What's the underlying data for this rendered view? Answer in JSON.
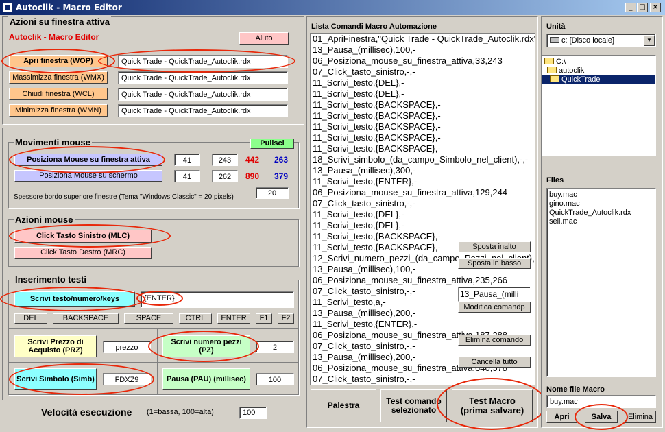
{
  "window": {
    "title": "Autoclik - Macro Editor",
    "min": "_",
    "max": "□",
    "close": "×"
  },
  "azioni_finestra": {
    "title": "Azioni su finestra attiva",
    "app_label": "Autoclik - Macro Editor",
    "aiuto": "Aiuto",
    "rows": [
      {
        "button": "Apri finestra (WOP)",
        "value": "Quick Trade - QuickTrade_Autoclik.rdx"
      },
      {
        "button": "Massimizza finestra (WMX)",
        "value": "Quick Trade - QuickTrade_Autoclik.rdx"
      },
      {
        "button": "Chiudi finestra (WCL)",
        "value": "Quick Trade - QuickTrade_Autoclik.rdx"
      },
      {
        "button": "Minimizza finestra (WMN)",
        "value": "Quick Trade - QuickTrade_Autoclik.rdx"
      }
    ]
  },
  "mouse_moves": {
    "title": "Movimenti mouse",
    "pulisci": "Pulisci",
    "pos_window": {
      "button": "Posiziona Mouse su finestra attiva",
      "x": "41",
      "y": "243",
      "red": "442",
      "blue": "263"
    },
    "pos_screen": {
      "button": "Posiziona Mouse su schermo",
      "x": "41",
      "y": "262",
      "red": "890",
      "blue": "379"
    },
    "border_label": "Spessore bordo superiore finestre  (Tema \"Windows Classic\" = 20 pixels)",
    "border_value": "20"
  },
  "mouse_actions": {
    "title": "Azioni mouse",
    "left": "Click Tasto Sinistro (MLC)",
    "right": "Click Tasto Destro (MRC)"
  },
  "text_input": {
    "title": "Inserimento testi",
    "write_button": "Scrivi testo/numero/keys",
    "write_value": "{ENTER}",
    "keys": [
      "DEL",
      "BACKSPACE",
      "SPACE",
      "CTRL",
      "ENTER",
      "F1",
      "F2"
    ],
    "prezzo_button": "Scrivi Prezzo di Acquisto (PRZ)",
    "prezzo_value": "prezzo",
    "pezzi_button": "Scrivi numero pezzi (PZ)",
    "pezzi_value": "2",
    "simbolo_button": "Scrivi Simbolo (Simb)",
    "simbolo_value": "FDXZ9",
    "pausa_button": "Pausa (PAU) (millisec)",
    "pausa_value": "100"
  },
  "speed": {
    "label": "Velocità esecuzione",
    "hint": "(1=bassa, 100=alta)",
    "value": "100"
  },
  "macro_list": {
    "title": "Lista Comandi Macro Automazione",
    "items": [
      "01_ApriFinestra,\"Quick Trade - QuickTrade_Autoclik.rdx\"",
      "13_Pausa_(millisec),100,-",
      "06_Posiziona_mouse_su_finestra_attiva,33,243",
      "07_Click_tasto_sinistro,-,-",
      "11_Scrivi_testo,{DEL},-",
      "11_Scrivi_testo,{DEL},-",
      "11_Scrivi_testo,{BACKSPACE},-",
      "11_Scrivi_testo,{BACKSPACE},-",
      "11_Scrivi_testo,{BACKSPACE},-",
      "11_Scrivi_testo,{BACKSPACE},-",
      "11_Scrivi_testo,{BACKSPACE},-",
      "18_Scrivi_simbolo_(da_campo_Simbolo_nel_client),-,-",
      "13_Pausa_(millisec),300,-",
      "11_Scrivi_testo,{ENTER},-",
      "06_Posiziona_mouse_su_finestra_attiva,129,244",
      "07_Click_tasto_sinistro,-,-",
      "11_Scrivi_testo,{DEL},-",
      "11_Scrivi_testo,{DEL},-",
      "11_Scrivi_testo,{BACKSPACE},-",
      "11_Scrivi_testo,{BACKSPACE},-",
      "12_Scrivi_numero_pezzi_(da_campo_Pezzi_nel_client),-,-",
      "13_Pausa_(millisec),100,-",
      "06_Posiziona_mouse_su_finestra_attiva,235,266",
      "07_Click_tasto_sinistro,-,-",
      "11_Scrivi_testo,a,-",
      "13_Pausa_(millisec),200,-",
      "11_Scrivi_testo,{ENTER},-",
      "06_Posiziona_mouse_su_finestra_attiva,187,288",
      "07_Click_tasto_sinistro,-,-",
      "13_Pausa_(millisec),200,-",
      "06_Posiziona_mouse_su_finestra_attiva,640,578",
      "07_Click_tasto_sinistro,-,-"
    ],
    "sposta_alto": "Sposta inalto",
    "sposta_basso": "Sposta in basso",
    "edit_value": "13_Pausa_(milli",
    "modifica": "Modifica comandp",
    "elimina": "Elimina comando",
    "cancella": "Cancella tutto",
    "palestra": "Palestra",
    "test_sel": "Test comando selezionato",
    "test_macro": "Test Macro (prima salvare)"
  },
  "files": {
    "unita_label": "Unità",
    "drive": "c: [Disco locale]",
    "folders": [
      "C:\\",
      "autoclik",
      "QuickTrade"
    ],
    "files_label": "Files",
    "files": [
      "buy.mac",
      "gino.mac",
      "QuickTrade_Autoclik.rdx",
      "sell.mac"
    ],
    "nome_label": "Nome file Macro",
    "nome_value": "buy.mac",
    "apri": "Apri",
    "salva": "Salva",
    "elimina": "Elimina"
  }
}
